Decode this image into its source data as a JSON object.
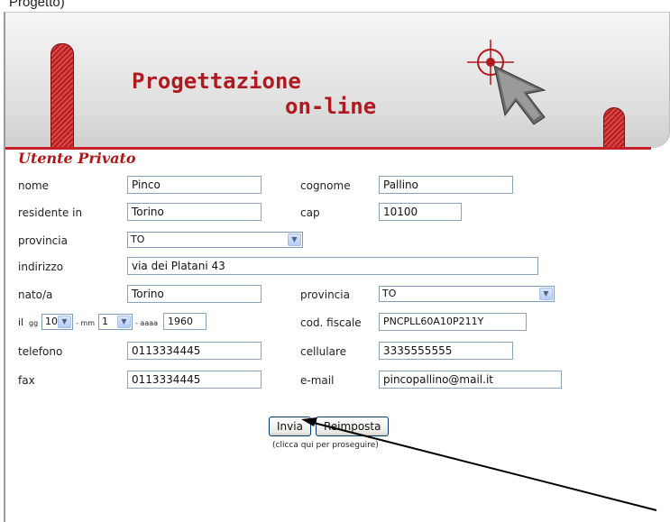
{
  "top_text": "Progetto)",
  "banner": {
    "logo_line1": "Progettazione",
    "logo_line2": "on-line"
  },
  "section_title": "Utente Privato",
  "form": {
    "nome_label": "nome",
    "nome_value": "Pinco",
    "cognome_label": "cognome",
    "cognome_value": "Pallino",
    "residente_label": "residente in",
    "residente_value": "Torino",
    "cap_label": "cap",
    "cap_value": "10100",
    "provincia_label": "provincia",
    "provincia_value": "TO",
    "indirizzo_label": "indirizzo",
    "indirizzo_value": "via dei Platani 43",
    "nato_label": "nato/a",
    "nato_value": "Torino",
    "nato_provincia_label": "provincia",
    "nato_provincia_value": "TO",
    "il_label": "il",
    "gg_label": "gg",
    "gg_value": "10",
    "mm_sep": "- mm",
    "mm_value": "1",
    "aaaa_sep": "- aaaa",
    "aaaa_value": "1960",
    "codfiscale_label": "cod. fiscale",
    "codfiscale_value": "PNCPLL60A10P211Y",
    "telefono_label": "telefono",
    "telefono_value": "0113334445",
    "cellulare_label": "cellulare",
    "cellulare_value": "3335555555",
    "fax_label": "fax",
    "fax_value": "0113334445",
    "email_label": "e-mail",
    "email_value": "pincopallino@mail.it"
  },
  "buttons": {
    "submit_label": "Invia",
    "reset_label": "Reimposta",
    "hint": "(clicca qui per proseguire)"
  },
  "colors": {
    "brand_red": "#b0191f",
    "field_border": "#8aa3bd"
  }
}
